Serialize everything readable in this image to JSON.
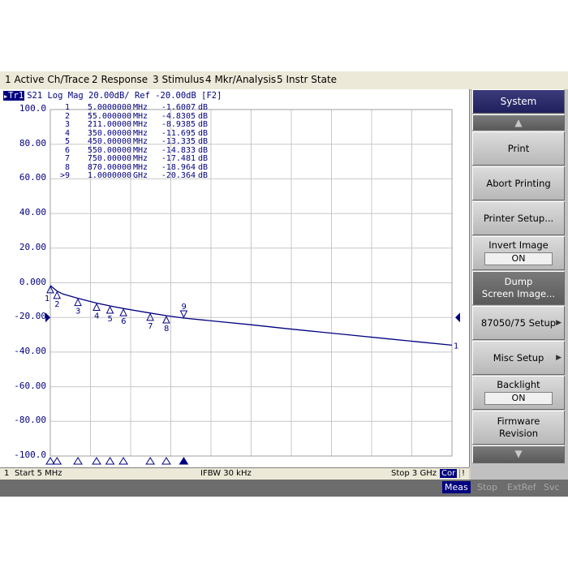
{
  "menu": [
    {
      "name": "menu-active-ch-trace",
      "label": "1 Active Ch/Trace"
    },
    {
      "name": "menu-response",
      "label": "2 Response"
    },
    {
      "name": "menu-stimulus",
      "label": "3 Stimulus"
    },
    {
      "name": "menu-mkr-analysis",
      "label": "4 Mkr/Analysis"
    },
    {
      "name": "menu-instr-state",
      "label": "5 Instr State"
    }
  ],
  "trace_header": {
    "badge": "Tr1",
    "text": "S21 Log Mag 20.00dB/ Ref -20.00dB [F2]"
  },
  "markers": [
    {
      "id": "1",
      "freq": "5.0000000",
      "unit": "MHz",
      "value": "-1.6007",
      "db": "dB",
      "f_mhz": 5
    },
    {
      "id": "2",
      "freq": "55.000000",
      "unit": "MHz",
      "value": "-4.8305",
      "db": "dB",
      "f_mhz": 55
    },
    {
      "id": "3",
      "freq": "211.00000",
      "unit": "MHz",
      "value": "-8.9385",
      "db": "dB",
      "f_mhz": 211
    },
    {
      "id": "4",
      "freq": "350.00000",
      "unit": "MHz",
      "value": "-11.695",
      "db": "dB",
      "f_mhz": 350
    },
    {
      "id": "5",
      "freq": "450.00000",
      "unit": "MHz",
      "value": "-13.335",
      "db": "dB",
      "f_mhz": 450
    },
    {
      "id": "6",
      "freq": "550.00000",
      "unit": "MHz",
      "value": "-14.833",
      "db": "dB",
      "f_mhz": 550
    },
    {
      "id": "7",
      "freq": "750.00000",
      "unit": "MHz",
      "value": "-17.481",
      "db": "dB",
      "f_mhz": 750
    },
    {
      "id": "8",
      "freq": "870.00000",
      "unit": "MHz",
      "value": "-18.964",
      "db": "dB",
      "f_mhz": 870
    },
    {
      "id": ">9",
      "freq": "1.0000000",
      "unit": "GHz",
      "value": "-20.364",
      "db": "dB",
      "f_mhz": 1000
    }
  ],
  "chart_data": {
    "type": "line",
    "x_unit": "MHz",
    "y_unit": "dB",
    "x_range": [
      5,
      3000
    ],
    "ylim": [
      -100,
      100
    ],
    "y_ticks": [
      "100.0",
      "80.00",
      "60.00",
      "40.00",
      "20.00",
      "0.000",
      "-20.00",
      "-40.00",
      "-60.00",
      "-80.00",
      "-100.0"
    ],
    "series": [
      {
        "x": [
          5,
          55,
          100,
          211,
          350,
          450,
          550,
          750,
          870,
          1000,
          1250,
          1500,
          1750,
          2000,
          2250,
          2500,
          2750,
          3000
        ],
        "y": [
          -1.6,
          -4.83,
          -6.5,
          -8.94,
          -11.7,
          -13.34,
          -14.83,
          -17.48,
          -18.96,
          -20.36,
          -22.3,
          -24.2,
          -26.3,
          -28.3,
          -30.2,
          -32.2,
          -34.1,
          -36.0
        ]
      }
    ],
    "ref_level": -20,
    "trace_end_label": "1",
    "color": "#000080"
  },
  "status": {
    "channel": "1",
    "start": "Start 5 MHz",
    "ifbw": "IFBW 30 kHz",
    "stop": "Stop 3 GHz",
    "cor": "Cor",
    "excl": "!"
  },
  "bottom": {
    "meas": "Meas",
    "stop": "Stop",
    "extref": "ExtRef",
    "svc": "Svc"
  },
  "softkeys": {
    "title": "System",
    "print": "Print",
    "abort_printing": "Abort Printing",
    "printer_setup": "Printer Setup...",
    "invert_image": "Invert Image",
    "invert_state": "ON",
    "dump_line1": "Dump",
    "dump_line2": "Screen Image...",
    "setup_87050": "87050/75 Setup",
    "misc_setup": "Misc Setup",
    "backlight": "Backlight",
    "backlight_state": "ON",
    "firmware_line1": "Firmware",
    "firmware_line2": "Revision"
  }
}
